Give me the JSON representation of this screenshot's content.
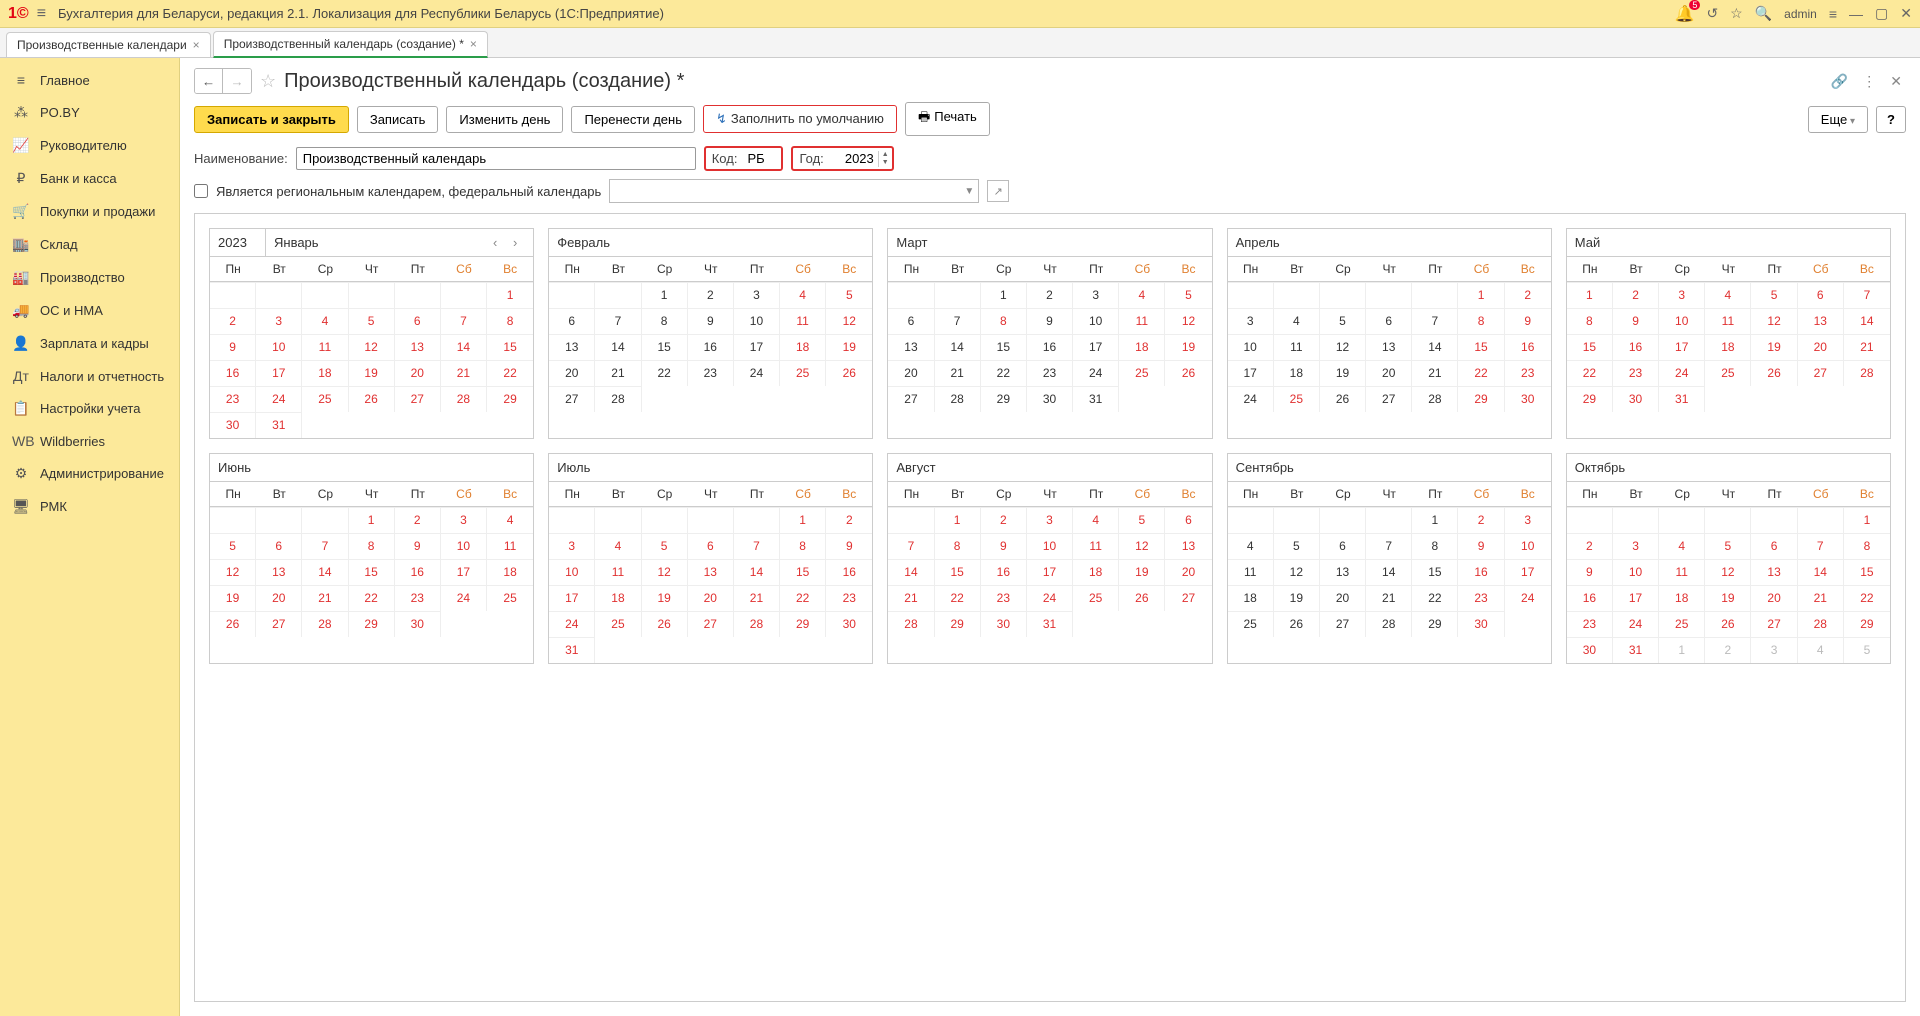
{
  "titlebar": {
    "title": "Бухгалтерия для Беларуси, редакция 2.1. Локализация для Республики Беларусь   (1С:Предприятие)",
    "user": "admin",
    "notification_count": "5"
  },
  "tabs": [
    {
      "label": "Производственные календари",
      "active": false
    },
    {
      "label": "Производственный календарь (создание) *",
      "active": true
    }
  ],
  "sidebar": [
    {
      "icon": "≡",
      "label": "Главное"
    },
    {
      "icon": "⁂",
      "label": "PO.BY"
    },
    {
      "icon": "📈",
      "label": "Руководителю"
    },
    {
      "icon": "₽",
      "label": "Банк и касса"
    },
    {
      "icon": "🛒",
      "label": "Покупки и продажи"
    },
    {
      "icon": "🏬",
      "label": "Склад"
    },
    {
      "icon": "🏭",
      "label": "Производство"
    },
    {
      "icon": "🚚",
      "label": "ОС и НМА"
    },
    {
      "icon": "👤",
      "label": "Зарплата и кадры"
    },
    {
      "icon": "Дт",
      "label": "Налоги и отчетность"
    },
    {
      "icon": "📋",
      "label": "Настройки учета"
    },
    {
      "icon": "WB",
      "label": "Wildberries"
    },
    {
      "icon": "⚙",
      "label": "Администрирование"
    },
    {
      "icon": "🖥",
      "label": "РМК"
    }
  ],
  "page": {
    "title": "Производственный календарь (создание) *",
    "btn_save_close": "Записать и закрыть",
    "btn_save": "Записать",
    "btn_change_day": "Изменить день",
    "btn_move_day": "Перенести день",
    "btn_fill_default": "Заполнить по умолчанию",
    "btn_print": "Печать",
    "btn_more": "Еще",
    "btn_help": "?",
    "label_name": "Наименование:",
    "name_value": "Производственный календарь",
    "label_code": "Код:",
    "code_value": "РБ",
    "label_year": "Год:",
    "year_value": "2023",
    "checkbox_regional": "Является региональным календарем, федеральный календарь"
  },
  "weekdays": [
    "Пн",
    "Вт",
    "Ср",
    "Чт",
    "Пт",
    "Сб",
    "Вс"
  ],
  "calendar_year": "2023",
  "months": [
    {
      "name": "Январь",
      "lead": 6,
      "ndays": 31,
      "all_red": true,
      "extras": []
    },
    {
      "name": "Февраль",
      "lead": 2,
      "ndays": 28,
      "all_red": false,
      "extras": []
    },
    {
      "name": "Март",
      "lead": 2,
      "ndays": 31,
      "all_red": false,
      "extras": [
        8
      ]
    },
    {
      "name": "Апрель",
      "lead": 5,
      "ndays": 30,
      "all_red": false,
      "extras": [
        25
      ]
    },
    {
      "name": "Май",
      "lead": 0,
      "ndays": 31,
      "all_red": true,
      "extras": []
    },
    {
      "name": "Июнь",
      "lead": 3,
      "ndays": 30,
      "all_red": true,
      "extras": []
    },
    {
      "name": "Июль",
      "lead": 5,
      "ndays": 31,
      "all_red": true,
      "extras": []
    },
    {
      "name": "Август",
      "lead": 1,
      "ndays": 31,
      "all_red": true,
      "extras": []
    },
    {
      "name": "Сентябрь",
      "lead": 4,
      "ndays": 30,
      "all_red": false,
      "extras": []
    },
    {
      "name": "Октябрь",
      "lead": 6,
      "ndays": 31,
      "all_red": true,
      "extras": [],
      "trailing": [
        1,
        2,
        3,
        4,
        5
      ]
    }
  ]
}
